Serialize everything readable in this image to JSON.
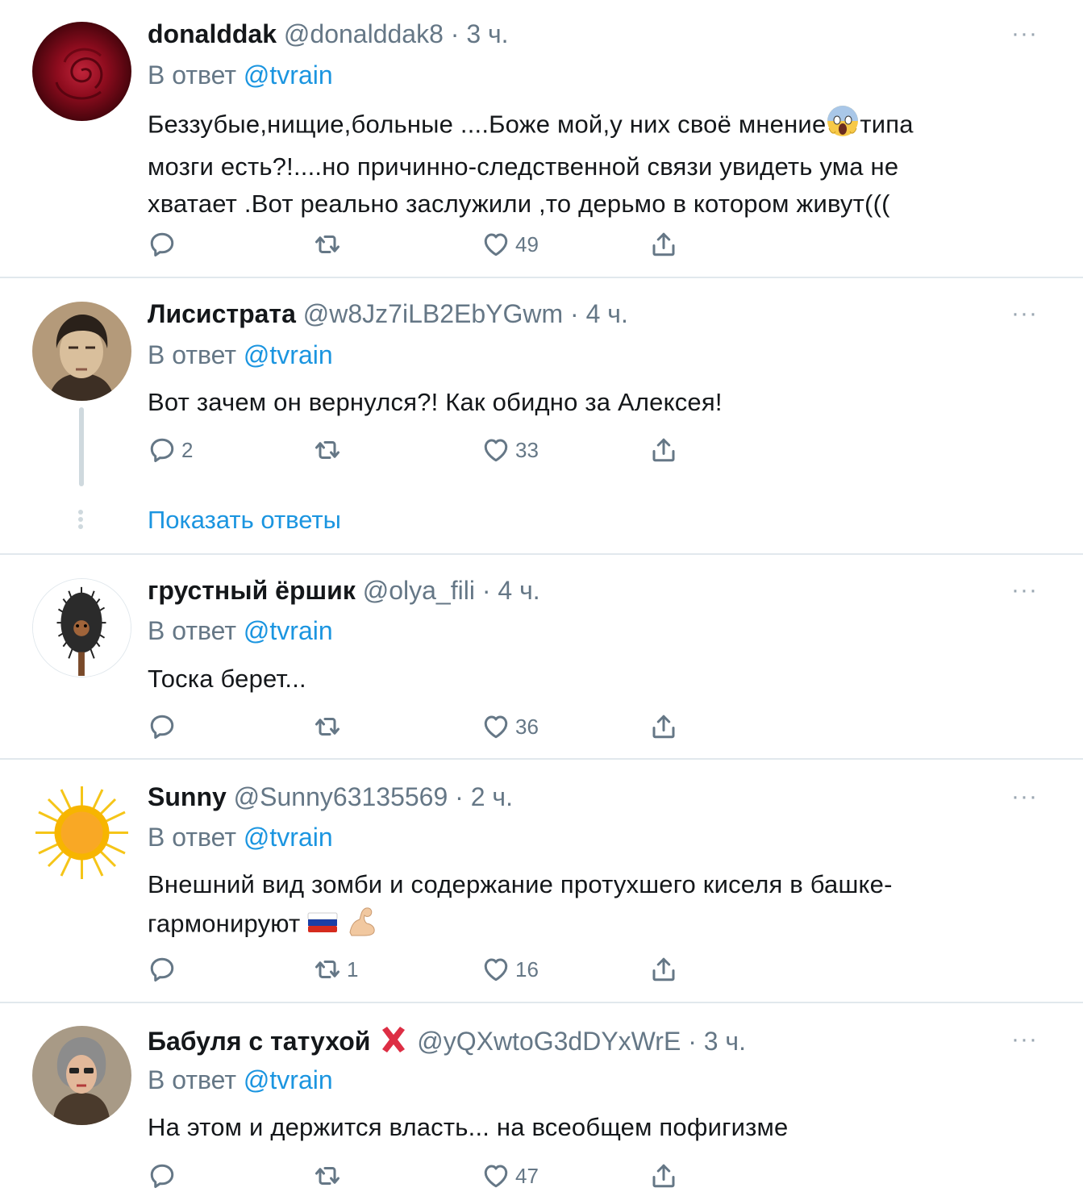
{
  "tweets": [
    {
      "name": "donalddak",
      "handle": "@donalddak8",
      "dot": "·",
      "time": "3 ч.",
      "reply_prefix": "В ответ",
      "reply_mention": "@tvrain",
      "text_lines": [
        "Беззубые,нищие,больные ....Боже мой,у них своё мнение",
        "типа",
        "мозги есть?!....но причинно-следственной связи увидеть ума  не",
        "хватает .Вот реально заслужили ,то дерьмо в котором живут((("
      ],
      "replies": "",
      "retweets": "",
      "likes": "49"
    },
    {
      "name": "Лисистрата",
      "handle": "@w8Jz7iLB2EbYGwm",
      "dot": "·",
      "time": "4 ч.",
      "reply_prefix": "В ответ",
      "reply_mention": "@tvrain",
      "text": "Вот зачем он вернулся?! Как обидно за Алексея!",
      "replies": "2",
      "retweets": "",
      "likes": "33",
      "show_replies": "Показать ответы"
    },
    {
      "name": "грустный ёршик",
      "handle": "@olya_fili",
      "dot": "·",
      "time": "4 ч.",
      "reply_prefix": "В ответ",
      "reply_mention": "@tvrain",
      "text": "Тоска берет...",
      "replies": "",
      "retweets": "",
      "likes": "36"
    },
    {
      "name": "Sunny",
      "handle": "@Sunny63135569",
      "dot": "·",
      "time": "2 ч.",
      "reply_prefix": "В ответ",
      "reply_mention": "@tvrain",
      "text_lines": [
        "Внешний вид зомби и содержание протухшего киселя в башке-",
        "гармонируют"
      ],
      "replies": "",
      "retweets": "1",
      "likes": "16"
    },
    {
      "name": "Бабуля с татухой",
      "handle": "@yQXwtoG3dDYxWrE",
      "dot": "·",
      "time": "3 ч.",
      "reply_prefix": "В ответ",
      "reply_mention": "@tvrain",
      "text": "На этом и держится власть... на всеобщем пофигизме",
      "replies": "",
      "retweets": "",
      "likes": "47"
    }
  ],
  "more_glyph": "···",
  "colors": {
    "accent": "#1b95e0",
    "muted": "#657786",
    "divider": "#e1e8ed"
  },
  "icons": [
    "reply-icon",
    "retweet-icon",
    "like-icon",
    "share-icon",
    "more-icon"
  ]
}
